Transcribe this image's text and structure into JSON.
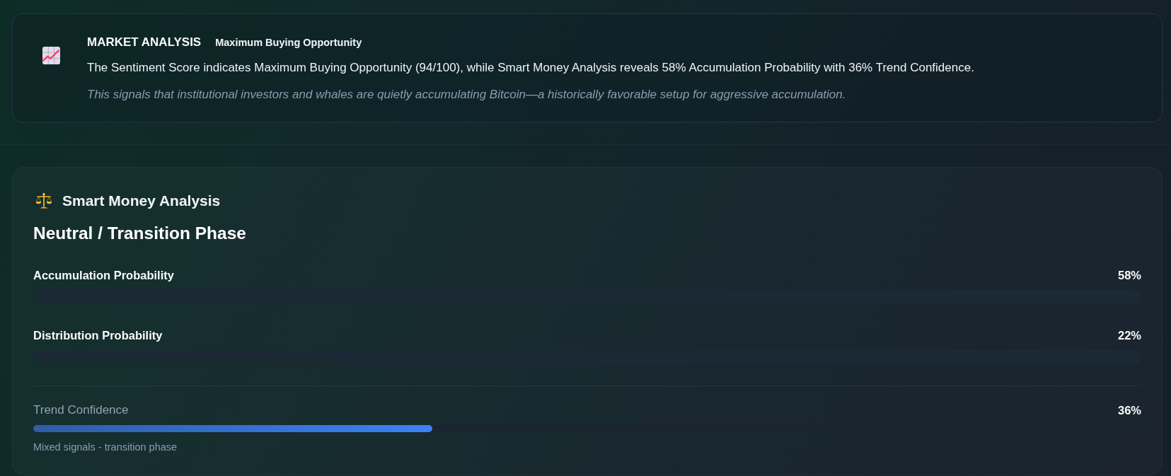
{
  "market_analysis": {
    "title": "MARKET ANALYSIS",
    "rating": "Maximum Buying Opportunity",
    "summary": "The Sentiment Score indicates Maximum Buying Opportunity (94/100), while Smart Money Analysis reveals 58% Accumulation Probability with 36% Trend Confidence.",
    "note": "This signals that institutional investors and whales are quietly accumulating Bitcoin—a historically favorable setup for aggressive accumulation."
  },
  "smart_money": {
    "title": "Smart Money Analysis",
    "phase": "Neutral / Transition Phase",
    "meters": [
      {
        "kind": "probability",
        "label": "Accumulation Probability",
        "reading": "58%"
      },
      {
        "kind": "probability",
        "label": "Distribution Probability",
        "reading": "22%"
      },
      {
        "kind": "confidence",
        "label": "Trend Confidence",
        "reading": "36%",
        "level": 0.36,
        "caption": "Mixed signals - transition phase"
      }
    ]
  }
}
